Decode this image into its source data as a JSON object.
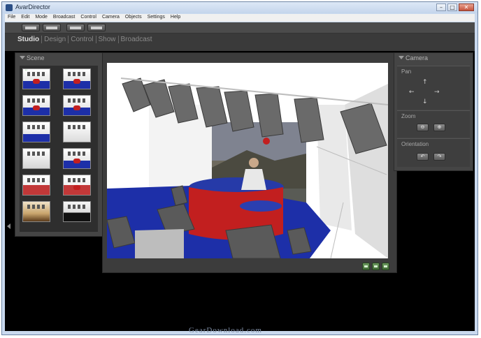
{
  "window": {
    "title": "AvarDirector",
    "controls": [
      "–",
      "□",
      "✕"
    ]
  },
  "menu": [
    "File",
    "Edit",
    "Mode",
    "Broadcast",
    "Control",
    "Camera",
    "Objects",
    "Settings",
    "Help"
  ],
  "modes": [
    "Studio",
    "Design",
    "Control",
    "Show",
    "Broadcast"
  ],
  "scene_panel": {
    "title": "Scene",
    "marker": "♫",
    "thumbnails": [
      "studio-1",
      "studio-2",
      "studio-3",
      "studio-4",
      "studio-5",
      "studio-6",
      "studio-7",
      "studio-8",
      "studio-9",
      "studio-10",
      "studio-11",
      "studio-12"
    ]
  },
  "camera_panel": {
    "title": "Camera",
    "pan_label": "Pan",
    "zoom_label": "Zoom",
    "orientation_label": "Orientation",
    "arrows": {
      "up": "↑",
      "left": "←",
      "right": "→",
      "down": "↓"
    },
    "zoom_buttons": [
      "zoom-out",
      "zoom-in"
    ],
    "orientation_buttons": [
      "rotate-left",
      "rotate-right"
    ]
  },
  "watermark": "GearDownload.com",
  "colors": {
    "floor": "#1d2fa8",
    "desk": "#c21f1f",
    "panel": "#454545",
    "chrome": "#c9d9ee"
  }
}
